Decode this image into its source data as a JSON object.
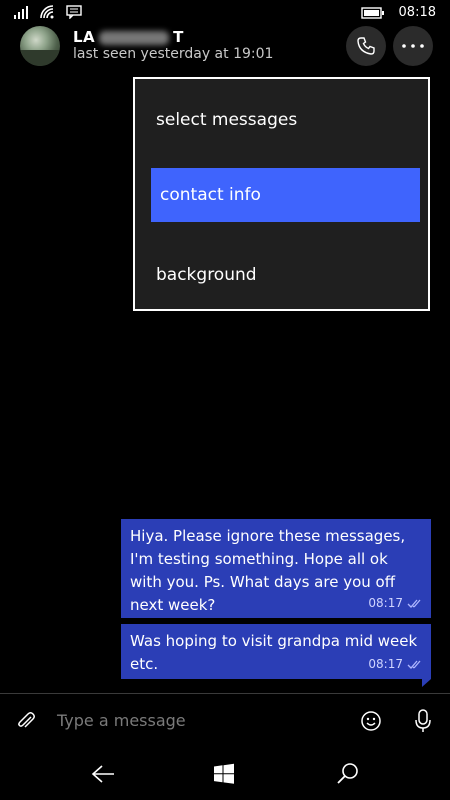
{
  "status": {
    "time": "08:18"
  },
  "contact": {
    "name_prefix": "LA",
    "name_suffix": "T",
    "last_seen": "last seen yesterday at 19:01"
  },
  "menu": {
    "items": [
      "select messages",
      "contact info",
      "background"
    ]
  },
  "messages": [
    {
      "text": "Hiya. Please ignore these messages, I'm testing something. Hope all ok with you. Ps. What days are you off next week?",
      "time": "08:17",
      "status_icon": "double-check-icon"
    },
    {
      "text": "Was hoping to visit grandpa mid week etc.",
      "time": "08:17",
      "status_icon": "double-check-icon"
    }
  ],
  "composer": {
    "placeholder": "Type a message"
  },
  "colors": {
    "menu_highlight": "#3f64fd",
    "bubble": "#2b3eb6",
    "background": "#000000"
  }
}
